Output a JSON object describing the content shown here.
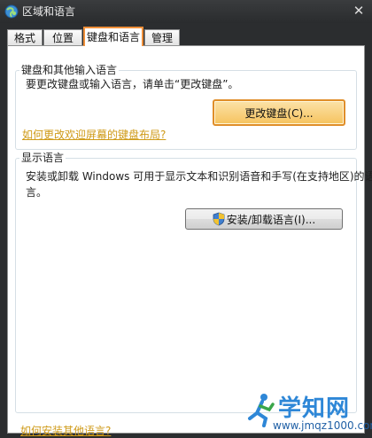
{
  "window": {
    "title": "区域和语言",
    "close_glyph": "✕"
  },
  "tabs": [
    {
      "label": "格式",
      "active": false
    },
    {
      "label": "位置",
      "active": false
    },
    {
      "label": "键盘和语言",
      "active": true
    },
    {
      "label": "管理",
      "active": false
    }
  ],
  "keyboard_group": {
    "title": "键盘和其他输入语言",
    "description": "要更改键盘或输入语言，请单击“更改键盘”。",
    "change_button": "更改键盘(C)...",
    "link": "如何更改欢迎屏幕的键盘布局?"
  },
  "display_group": {
    "title": "显示语言",
    "description_line1": "安装或卸载 Windows 可用于显示文本和识别语音和手写(在支持地区)的语",
    "description_line2": "言。",
    "install_button": "安装/卸载语言(I)..."
  },
  "bottom_link": "如何安装其他语言?",
  "watermark": {
    "title": "学知网",
    "url": "www.jmqz1000.com"
  },
  "colors": {
    "accent_orange": "#f0903a",
    "link": "#cf9a17",
    "watermark_blue": "#2e87d7"
  },
  "icons": [
    "globe-icon",
    "close-icon",
    "uac-shield-icon"
  ]
}
